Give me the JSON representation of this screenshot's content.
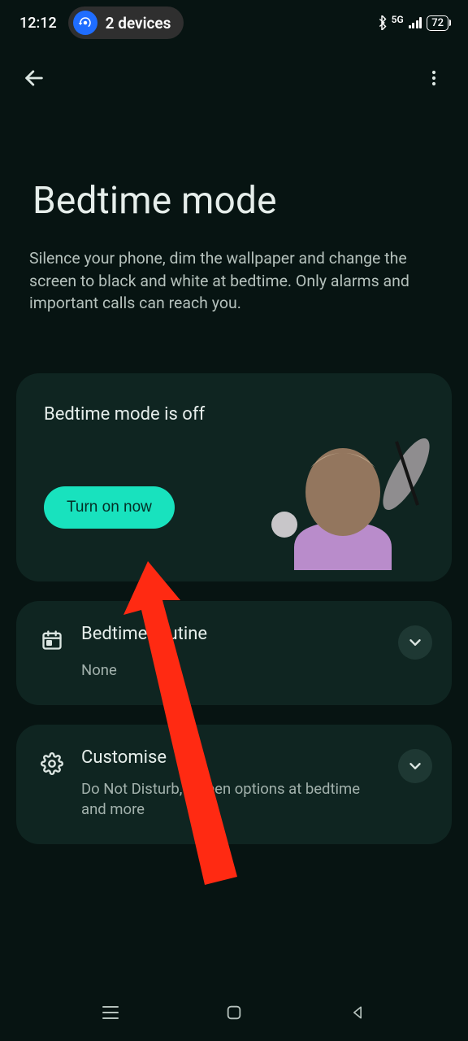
{
  "status": {
    "time": "12:12",
    "devices_label": "2 devices",
    "net_label": "5G",
    "battery": "72"
  },
  "header": {
    "title": "Bedtime mode",
    "description": "Silence your phone, dim the wallpaper and change the screen to black and white at bedtime. Only alarms and important calls can reach you."
  },
  "status_card": {
    "label": "Bedtime mode is off",
    "button": "Turn on now"
  },
  "routine": {
    "title": "Bedtime routine",
    "value": "None"
  },
  "customise": {
    "title": "Customise",
    "subtitle": "Do Not Disturb, screen options at bedtime and more"
  }
}
